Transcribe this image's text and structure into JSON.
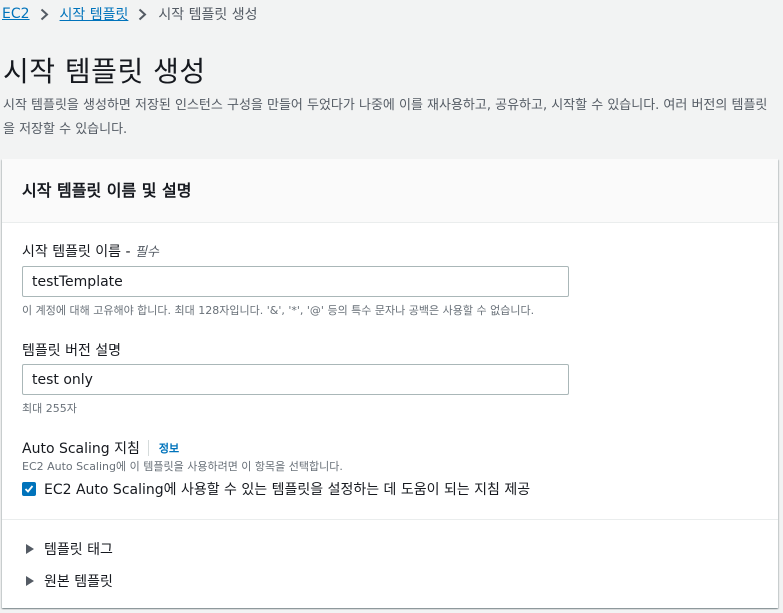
{
  "breadcrumb": {
    "items": [
      {
        "label": "EC2"
      },
      {
        "label": "시작 템플릿"
      },
      {
        "label": "시작 템플릿 생성"
      }
    ]
  },
  "page": {
    "title": "시작 템플릿 생성",
    "description": "시작 템플릿을 생성하면 저장된 인스턴스 구성을 만들어 두었다가 나중에 이를 재사용하고, 공유하고, 시작할 수 있습니다. 여러 버전의 템플릿을 저장할 수 있습니다."
  },
  "panel": {
    "title": "시작 템플릿 이름 및 설명",
    "name_field": {
      "label": "시작 템플릿 이름 -",
      "required": "필수",
      "value": "testTemplate",
      "hint": "이 계정에 대해 고유해야 합니다. 최대 128자입니다. '&', '*', '@' 등의 특수 문자나 공백은 사용할 수 없습니다."
    },
    "desc_field": {
      "label": "템플릿 버전 설명",
      "value": "test only",
      "hint": "최대 255자"
    },
    "autoscaling": {
      "label": "Auto Scaling 지침",
      "info": "정보",
      "hint": "EC2 Auto Scaling에 이 템플릿을 사용하려면 이 항목을 선택합니다.",
      "checkbox_label": "EC2 Auto Scaling에 사용할 수 있는 템플릿을 설정하는 데 도움이 되는 지침 제공",
      "checked": true
    },
    "expanders": [
      {
        "label": "템플릿 태그"
      },
      {
        "label": "원본 템플릿"
      }
    ]
  },
  "colors": {
    "link": "#0073bb",
    "background": "#f2f3f3",
    "text": "#16191f",
    "muted": "#545b64"
  }
}
